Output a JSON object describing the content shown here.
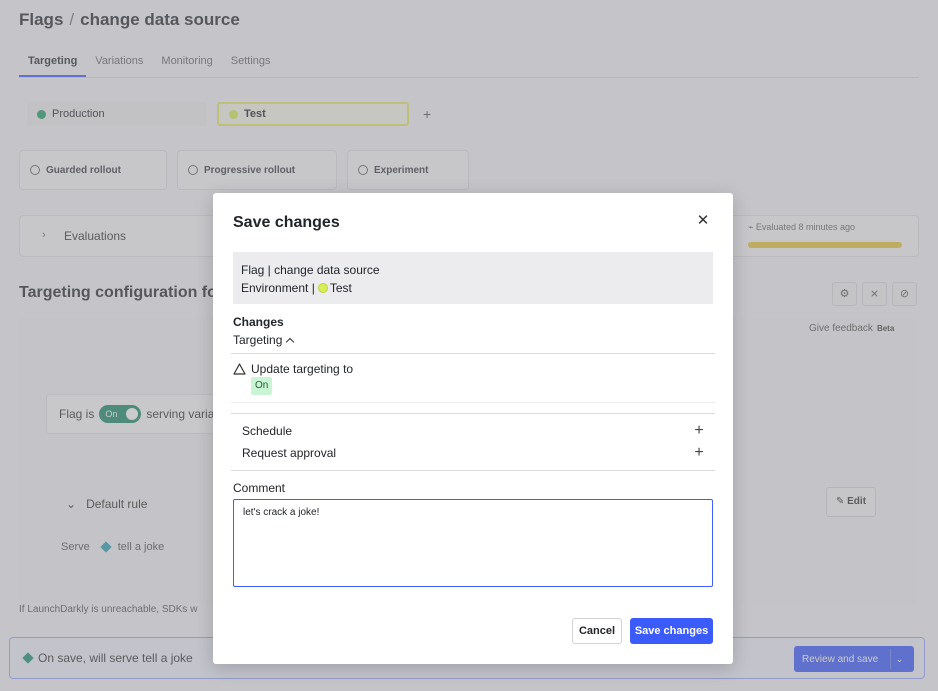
{
  "page": {
    "breadcrumb_root": "Flags",
    "breadcrumb_sep": "/",
    "flag_name": "change data source",
    "tabs": [
      {
        "label": "Targeting"
      },
      {
        "label": "Variations"
      },
      {
        "label": "Monitoring"
      },
      {
        "label": "Settings"
      }
    ],
    "environments": [
      {
        "label": "Production",
        "color": "#1f9e6b"
      },
      {
        "label": "Test",
        "color": "#d7ef55"
      }
    ],
    "add_env_label": "+",
    "rollouts": [
      {
        "label": "Guarded rollout"
      },
      {
        "label": "Progressive rollout"
      },
      {
        "label": "Experiment"
      }
    ],
    "evaluations_label": "Evaluations",
    "evaluated_text": "Evaluated 8 minutes ago",
    "targeting_config_title": "Targeting configuration fo",
    "give_feedback": "Give feedback",
    "beta": "Beta",
    "flag_is": "Flag is",
    "toggle_on": "On",
    "serving_text": "serving varia",
    "default_rule": "Default rule",
    "serve_label": "Serve",
    "serve_value": "tell a joke",
    "edit_label": "Edit",
    "unreachable_text": "If LaunchDarkly is unreachable, SDKs w",
    "save_bar_text": "On save, will serve tell a joke",
    "review_button": "Review and save"
  },
  "modal": {
    "title": "Save changes",
    "summary_flag": "Flag | change data source",
    "summary_env_prefix": "Environment |",
    "summary_env": "Test",
    "changes_heading": "Changes",
    "targeting_label": "Targeting",
    "update_text": "Update targeting to",
    "on_badge": "On",
    "schedule_label": "Schedule",
    "request_approval_label": "Request approval",
    "comment_label": "Comment",
    "comment_value": "let's crack a joke!",
    "cancel_label": "Cancel",
    "save_label": "Save changes",
    "accent_color": "#3b5bfd"
  }
}
